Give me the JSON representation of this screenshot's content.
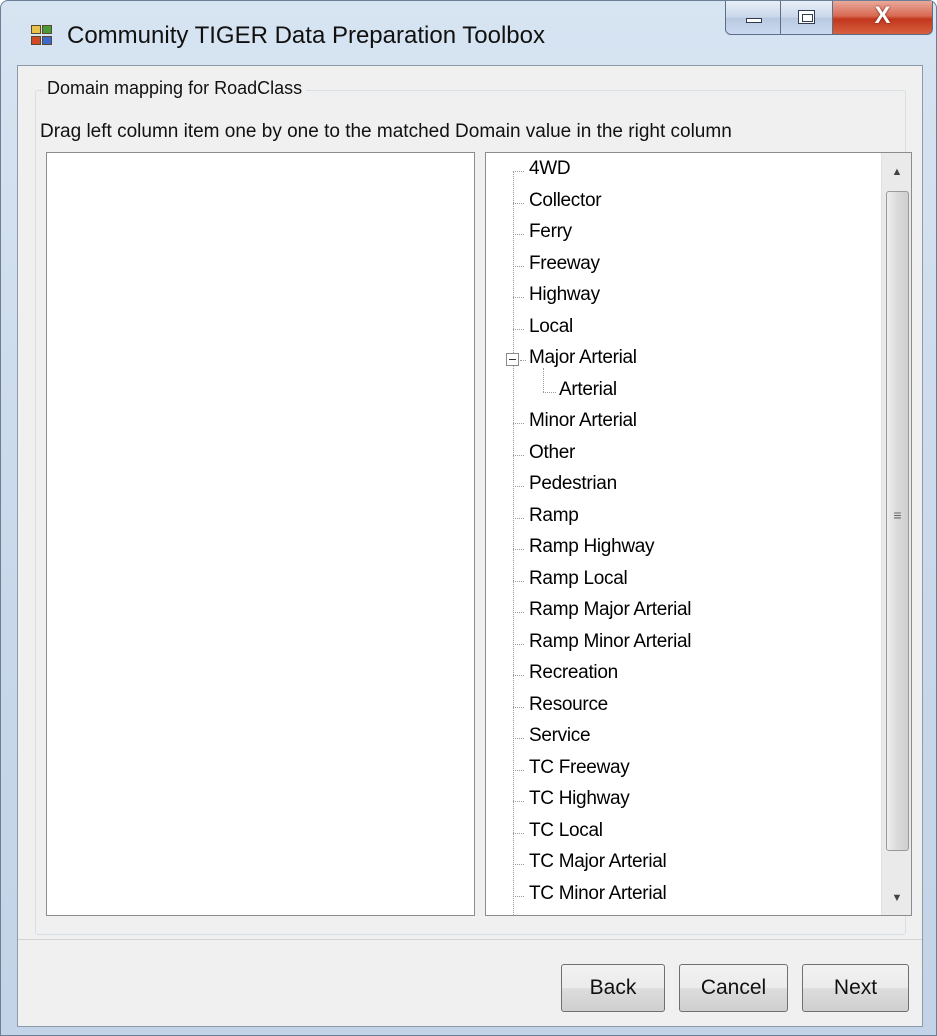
{
  "window": {
    "title": "Community TIGER Data Preparation Toolbox",
    "close_glyph": "X"
  },
  "group": {
    "legend": "Domain mapping for RoadClass",
    "instruction": "Drag left column item one by one to the matched Domain value in the right column"
  },
  "left_list": {
    "items": []
  },
  "tree": {
    "items": [
      {
        "label": "4WD",
        "level": 0
      },
      {
        "label": "Collector",
        "level": 0
      },
      {
        "label": "Ferry",
        "level": 0
      },
      {
        "label": "Freeway",
        "level": 0
      },
      {
        "label": "Highway",
        "level": 0
      },
      {
        "label": "Local",
        "level": 0
      },
      {
        "label": "Major Arterial",
        "level": 0,
        "expanded": true
      },
      {
        "label": "Arterial",
        "level": 1
      },
      {
        "label": "Minor Arterial",
        "level": 0
      },
      {
        "label": "Other",
        "level": 0
      },
      {
        "label": "Pedestrian",
        "level": 0
      },
      {
        "label": "Ramp",
        "level": 0
      },
      {
        "label": "Ramp Highway",
        "level": 0
      },
      {
        "label": "Ramp Local",
        "level": 0
      },
      {
        "label": "Ramp Major Arterial",
        "level": 0
      },
      {
        "label": "Ramp Minor Arterial",
        "level": 0
      },
      {
        "label": "Recreation",
        "level": 0
      },
      {
        "label": "Resource",
        "level": 0
      },
      {
        "label": "Service",
        "level": 0
      },
      {
        "label": "TC Freeway",
        "level": 0
      },
      {
        "label": "TC Highway",
        "level": 0
      },
      {
        "label": "TC Local",
        "level": 0
      },
      {
        "label": "TC Major Arterial",
        "level": 0
      },
      {
        "label": "TC Minor Arterial",
        "level": 0
      }
    ]
  },
  "scrollbar": {
    "up": "▲",
    "down": "▼",
    "grip": "≡"
  },
  "buttons": {
    "back": "Back",
    "cancel": "Cancel",
    "next": "Next"
  },
  "colors": {
    "client_bg": "#f0f0f0",
    "close_button": "#c2371d"
  }
}
